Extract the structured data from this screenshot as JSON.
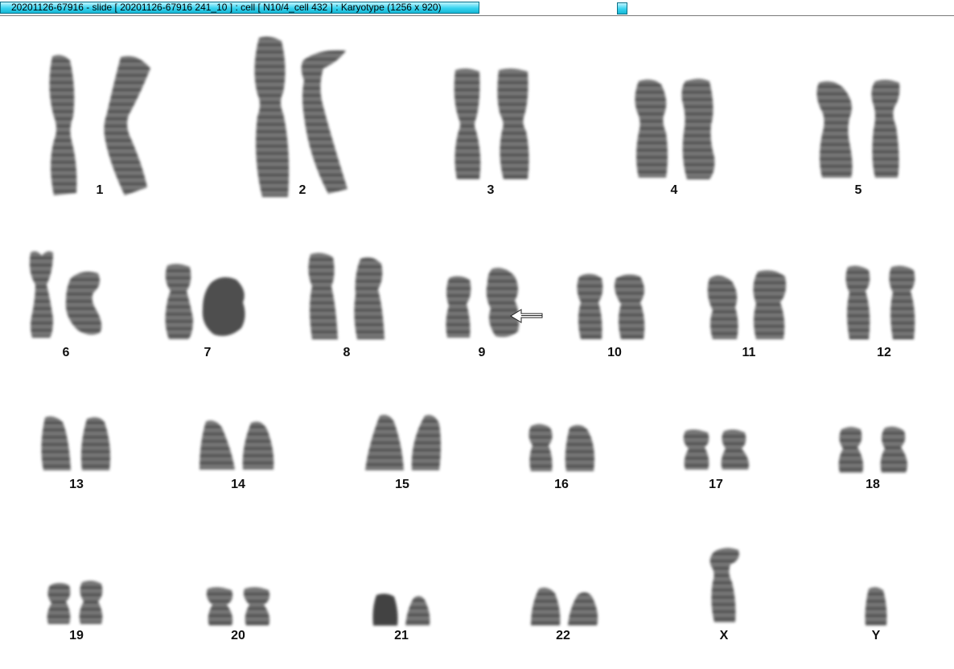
{
  "window": {
    "title": "20201126-67916 - slide [ 20201126-67916 241_10 ] : cell [ N10/4_cell 432 ] : Karyotype  (1256 x 920)"
  },
  "colors": {
    "title_tab": "#37d3ef",
    "chromosome_dark": "#2f2f2f",
    "chromosome_light": "#8a8a8a"
  },
  "karyotype": {
    "labels": {
      "c1": "1",
      "c2": "2",
      "c3": "3",
      "c4": "4",
      "c5": "5",
      "c6": "6",
      "c7": "7",
      "c8": "8",
      "c9": "9",
      "c10": "10",
      "c11": "11",
      "c12": "12",
      "c13": "13",
      "c14": "14",
      "c15": "15",
      "c16": "16",
      "c17": "17",
      "c18": "18",
      "c19": "19",
      "c20": "20",
      "c21": "21",
      "c22": "22",
      "cX": "X",
      "cY": "Y"
    },
    "marker": {
      "chromosome": "9",
      "icon": "arrow-left-icon"
    }
  }
}
